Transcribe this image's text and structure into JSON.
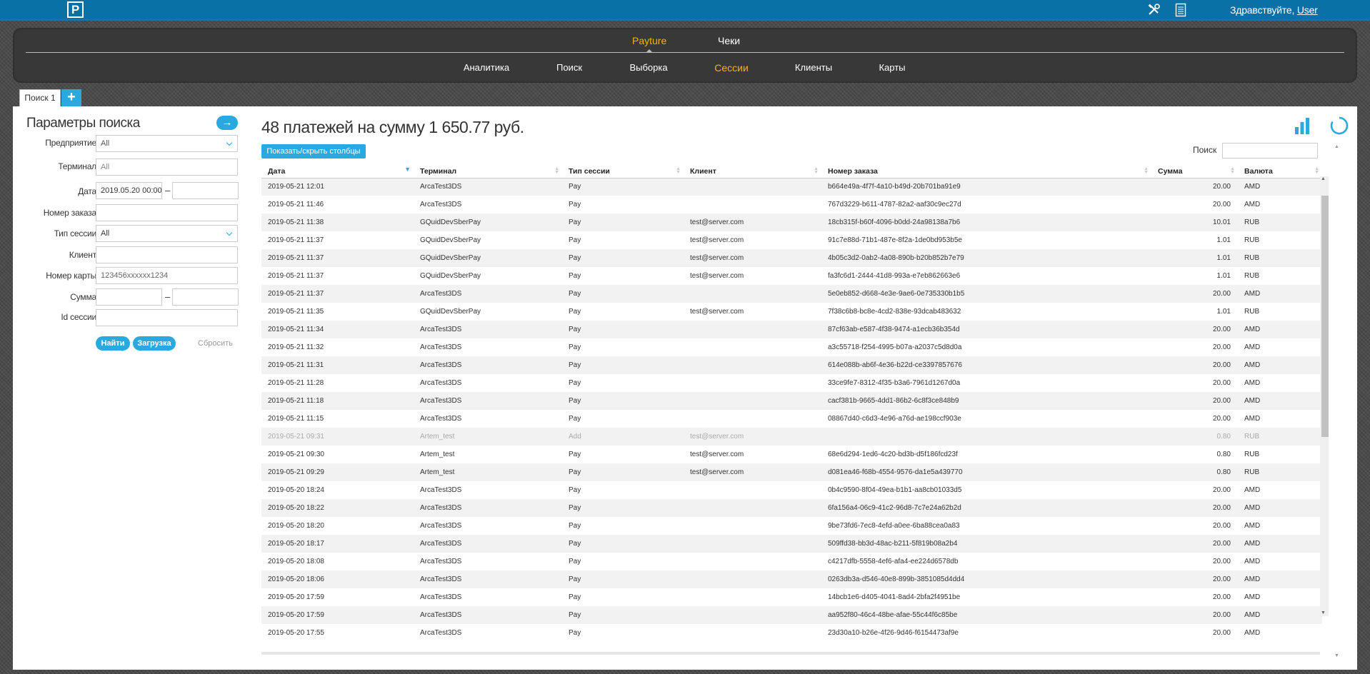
{
  "header": {
    "logo_text": "P",
    "greeting": "Здравствуйте,",
    "user": "User",
    "icons": [
      "tools-icon",
      "document-icon"
    ]
  },
  "nav": {
    "top_tabs": [
      {
        "label": "Payture",
        "active": true
      },
      {
        "label": "Чеки",
        "active": false
      }
    ],
    "sub_items": [
      {
        "label": "Аналитика",
        "active": false
      },
      {
        "label": "Поиск",
        "active": false
      },
      {
        "label": "Выборка",
        "active": false
      },
      {
        "label": "Сессии",
        "active": true
      },
      {
        "label": "Клиенты",
        "active": false
      },
      {
        "label": "Карты",
        "active": false
      }
    ]
  },
  "tabs": {
    "current": "Поиск 1",
    "add_label": "+"
  },
  "search_params": {
    "title": "Параметры поиска",
    "arrow": "→",
    "fields": {
      "enterprise": {
        "label": "Предприятие",
        "value": "All"
      },
      "terminal": {
        "label": "Терминал",
        "placeholder": "All"
      },
      "date": {
        "label": "Дата",
        "from": "2019.05.20 00:00",
        "to": ""
      },
      "order_number": {
        "label": "Номер заказа",
        "value": ""
      },
      "session_type": {
        "label": "Тип сессии",
        "value": "All"
      },
      "client": {
        "label": "Клиент",
        "value": ""
      },
      "card_number": {
        "label": "Номер карты",
        "placeholder": "123456xxxxxx1234"
      },
      "amount": {
        "label": "Сумма",
        "from": "",
        "to": ""
      },
      "session_id": {
        "label": "Id сессии",
        "value": ""
      }
    },
    "dash": "–",
    "buttons": {
      "find": "Найти",
      "load": "Загрузка",
      "reset": "Сбросить"
    }
  },
  "results": {
    "title": "48 платежей на сумму 1 650.77 руб.",
    "toggle_columns": "Показать/скрыть столбцы",
    "search_label": "Поиск",
    "columns": [
      "Дата",
      "Терминал",
      "Тип сессии",
      "Клиент",
      "Номер заказа",
      "Сумма",
      "Валюта"
    ],
    "sorted_column": "Дата",
    "rows": [
      [
        "2019-05-21 12:01",
        "ArcaTest3DS",
        "Pay",
        "",
        "b664e49a-4f7f-4a10-b49d-20b701ba91e9",
        "20.00",
        "AMD"
      ],
      [
        "2019-05-21 11:46",
        "ArcaTest3DS",
        "Pay",
        "",
        "767d3229-b611-4787-82a2-aaf30c9ec27d",
        "20.00",
        "AMD"
      ],
      [
        "2019-05-21 11:38",
        "GQuidDevSberPay",
        "Pay",
        "test@server.com",
        "18cb315f-b60f-4096-b0dd-24a98138a7b6",
        "10.01",
        "RUB"
      ],
      [
        "2019-05-21 11:37",
        "GQuidDevSberPay",
        "Pay",
        "test@server.com",
        "91c7e88d-71b1-487e-8f2a-1de0bd953b5e",
        "1.01",
        "RUB"
      ],
      [
        "2019-05-21 11:37",
        "GQuidDevSberPay",
        "Pay",
        "test@server.com",
        "4b05c3d2-0ab2-4a08-890b-b20b852b7e79",
        "1.01",
        "RUB"
      ],
      [
        "2019-05-21 11:37",
        "GQuidDevSberPay",
        "Pay",
        "test@server.com",
        "fa3fc6d1-2444-41d8-993a-e7eb862663e6",
        "1.01",
        "RUB"
      ],
      [
        "2019-05-21 11:37",
        "ArcaTest3DS",
        "Pay",
        "",
        "5e0eb852-d668-4e3e-9ae6-0e735330b1b5",
        "20.00",
        "AMD"
      ],
      [
        "2019-05-21 11:35",
        "GQuidDevSberPay",
        "Pay",
        "test@server.com",
        "7f38c6b8-bc8e-4cd2-838e-93dcab483632",
        "1.01",
        "RUB"
      ],
      [
        "2019-05-21 11:34",
        "ArcaTest3DS",
        "Pay",
        "",
        "87cf63ab-e587-4f38-9474-a1ecb36b354d",
        "20.00",
        "AMD"
      ],
      [
        "2019-05-21 11:32",
        "ArcaTest3DS",
        "Pay",
        "",
        "a3c55718-f254-4995-b07a-a2037c5d8d0a",
        "20.00",
        "AMD"
      ],
      [
        "2019-05-21 11:31",
        "ArcaTest3DS",
        "Pay",
        "",
        "614e088b-ab6f-4e36-b22d-ce3397857676",
        "20.00",
        "AMD"
      ],
      [
        "2019-05-21 11:28",
        "ArcaTest3DS",
        "Pay",
        "",
        "33ce9fe7-8312-4f35-b3a6-7961d1267d0a",
        "20.00",
        "AMD"
      ],
      [
        "2019-05-21 11:18",
        "ArcaTest3DS",
        "Pay",
        "",
        "cacf381b-9665-4dd1-86b2-6c8f3ce848b9",
        "20.00",
        "AMD"
      ],
      [
        "2019-05-21 11:15",
        "ArcaTest3DS",
        "Pay",
        "",
        "08867d40-c6d3-4e96-a76d-ae198ccf903e",
        "20.00",
        "AMD"
      ],
      [
        "2019-05-21 09:31",
        "Artem_test",
        "Add",
        "test@server.com",
        "",
        "0.80",
        "RUB"
      ],
      [
        "2019-05-21 09:30",
        "Artem_test",
        "Pay",
        "test@server.com",
        "68e6d294-1ed6-4c20-bd3b-d5f186fcd23f",
        "0.80",
        "RUB"
      ],
      [
        "2019-05-21 09:29",
        "Artem_test",
        "Pay",
        "test@server.com",
        "d081ea46-f68b-4554-9576-da1e5a439770",
        "0.80",
        "RUB"
      ],
      [
        "2019-05-20 18:24",
        "ArcaTest3DS",
        "Pay",
        "",
        "0b4c9590-8f04-49ea-b1b1-aa8cb01033d5",
        "20.00",
        "AMD"
      ],
      [
        "2019-05-20 18:22",
        "ArcaTest3DS",
        "Pay",
        "",
        "6fa156a4-06c9-41c2-96d8-7c7e24a62b2d",
        "20.00",
        "AMD"
      ],
      [
        "2019-05-20 18:20",
        "ArcaTest3DS",
        "Pay",
        "",
        "9be73fd6-7ec8-4efd-a0ee-6ba88cea0a83",
        "20.00",
        "AMD"
      ],
      [
        "2019-05-20 18:17",
        "ArcaTest3DS",
        "Pay",
        "",
        "509ffd38-bb3d-48ac-b211-5f819b08a2b4",
        "20.00",
        "AMD"
      ],
      [
        "2019-05-20 18:08",
        "ArcaTest3DS",
        "Pay",
        "",
        "c4217dfb-5558-4ef6-afa4-ee224d6578db",
        "20.00",
        "AMD"
      ],
      [
        "2019-05-20 18:06",
        "ArcaTest3DS",
        "Pay",
        "",
        "0263db3a-d546-40e8-899b-3851085d4dd4",
        "20.00",
        "AMD"
      ],
      [
        "2019-05-20 17:59",
        "ArcaTest3DS",
        "Pay",
        "",
        "14bcb1e6-d405-4041-8ad4-2bfa2f4951be",
        "20.00",
        "AMD"
      ],
      [
        "2019-05-20 17:59",
        "ArcaTest3DS",
        "Pay",
        "",
        "aa952f80-46c4-48be-afae-55c44f6c85be",
        "20.00",
        "AMD"
      ],
      [
        "2019-05-20 17:55",
        "ArcaTest3DS",
        "Pay",
        "",
        "23d30a10-b26e-4f26-9d46-f6154473af9e",
        "20.00",
        "AMD"
      ]
    ],
    "muted_row_index": 14
  },
  "colors": {
    "accent": "#29a9e0",
    "header": "#0a71a6",
    "nav_active": "#f7b500",
    "nav_bg": "#383838"
  }
}
